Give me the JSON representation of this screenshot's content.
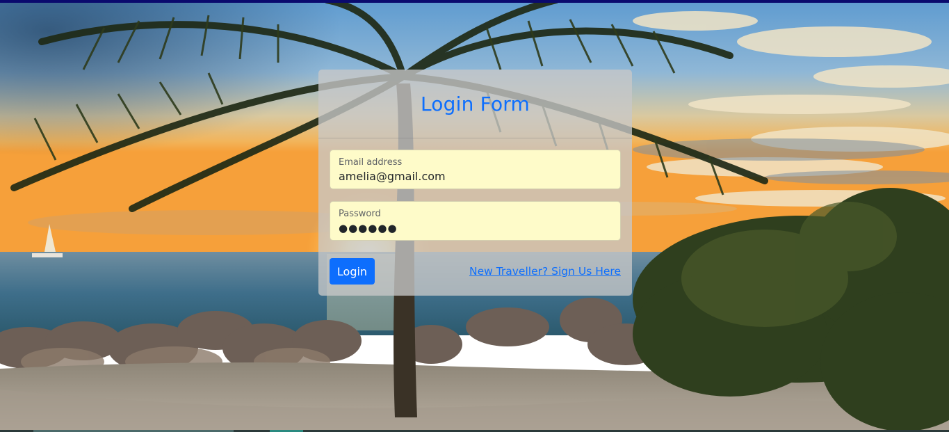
{
  "form": {
    "title": "Login Form",
    "email": {
      "label": "Email address",
      "value": "amelia@gmail.com"
    },
    "password": {
      "label": "Password",
      "value": "●●●●●●"
    },
    "login_button": "Login",
    "signup_link": "New Traveller? Sign Us Here"
  },
  "colors": {
    "accent": "#0d6efd",
    "input_background": "#fefbc9",
    "card_background": "rgba(200,200,200,0.78)"
  },
  "background": {
    "description_icon": "beach-sunset-palm-background"
  }
}
